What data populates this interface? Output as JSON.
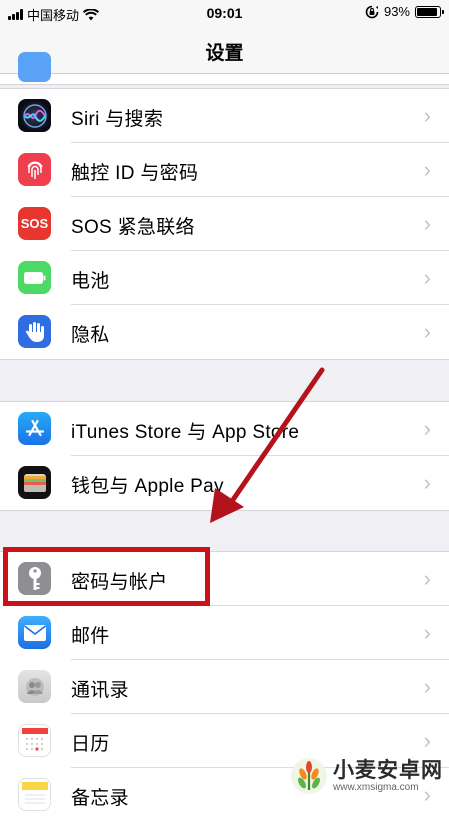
{
  "status_bar": {
    "carrier": "中国移动",
    "time": "09:01",
    "battery_percent": "93%",
    "battery_level": 0.93
  },
  "nav": {
    "title": "设置"
  },
  "groups": [
    {
      "rows": [
        {
          "label": "Siri 与搜索",
          "icon": "siri-icon",
          "icon_color": "#1a1a2e"
        },
        {
          "label": "触控 ID 与密码",
          "icon": "fingerprint-icon",
          "icon_color": "#ef3f4f"
        },
        {
          "label": "SOS 紧急联络",
          "icon": "sos-icon",
          "icon_text": "SOS",
          "icon_color": "#e6362e"
        },
        {
          "label": "电池",
          "icon": "battery-icon",
          "icon_color": "#4cd964"
        },
        {
          "label": "隐私",
          "icon": "hand-icon",
          "icon_color": "#2f6ee0"
        }
      ]
    },
    {
      "rows": [
        {
          "label": "iTunes Store 与 App Store",
          "icon": "app-store-icon",
          "icon_color": "#1e8cf0"
        },
        {
          "label": "钱包与 Apple Pay",
          "icon": "wallet-icon",
          "icon_color": "#111111"
        }
      ]
    },
    {
      "rows": [
        {
          "label": "密码与帐户",
          "icon": "key-icon",
          "icon_color": "#8e8e93"
        },
        {
          "label": "邮件",
          "icon": "mail-icon",
          "icon_color": "#1f8cf2"
        },
        {
          "label": "通讯录",
          "icon": "contacts-icon",
          "icon_color": "#d9d9d9"
        },
        {
          "label": "日历",
          "icon": "calendar-icon",
          "icon_color": "#ffffff"
        },
        {
          "label": "备忘录",
          "icon": "notes-icon",
          "icon_color": "#fbd544"
        }
      ]
    }
  ],
  "annotation": {
    "color": "#cc1218"
  },
  "watermark": {
    "main": "小麦安卓网",
    "sub": "www.xmsigma.com"
  }
}
